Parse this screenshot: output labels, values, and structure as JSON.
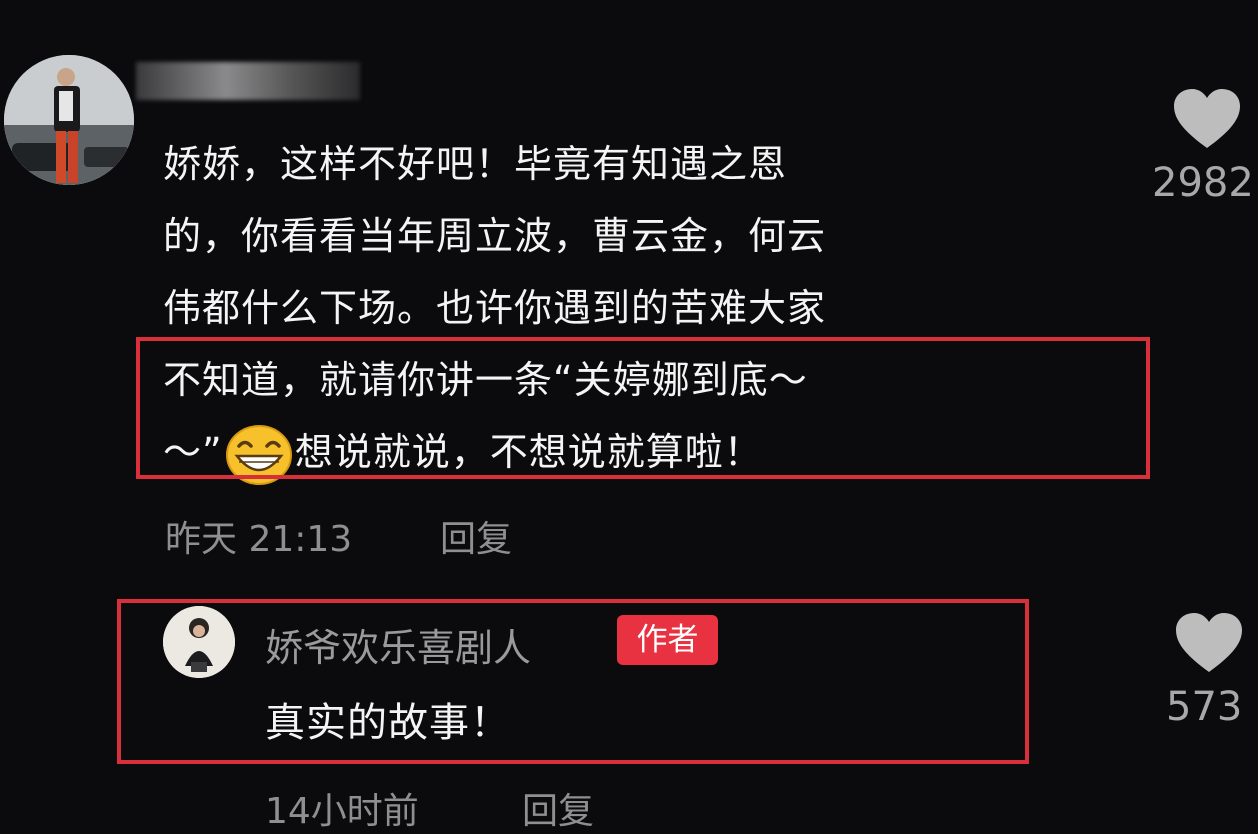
{
  "comment": {
    "lines": [
      "娇娇，这样不好吧！毕竟有知遇之恩",
      "的，你看看当年周立波，曹云金，何云",
      "伟都什么下场。也许你遇到的苦难大家",
      "不知道，就请你讲一条“关婷娜到底～"
    ],
    "line5_before_emoji": "～”",
    "line5_after_emoji": "想说就说，不想说就算啦！",
    "emoji_icon": "grinning-face-emoji",
    "time": "昨天 21:13",
    "reply_label": "回复",
    "likes": "2982"
  },
  "reply": {
    "author_name": "娇爷欢乐喜剧人",
    "author_badge": "作者",
    "text": "真实的故事！",
    "time": "14小时前",
    "reply_label": "回复",
    "likes": "573"
  },
  "colors": {
    "background": "#0b0b0d",
    "highlight_border": "#d8303a",
    "badge": "#e83241",
    "meta_text": "#8f8f8f",
    "heart": "#bdbdbd"
  }
}
